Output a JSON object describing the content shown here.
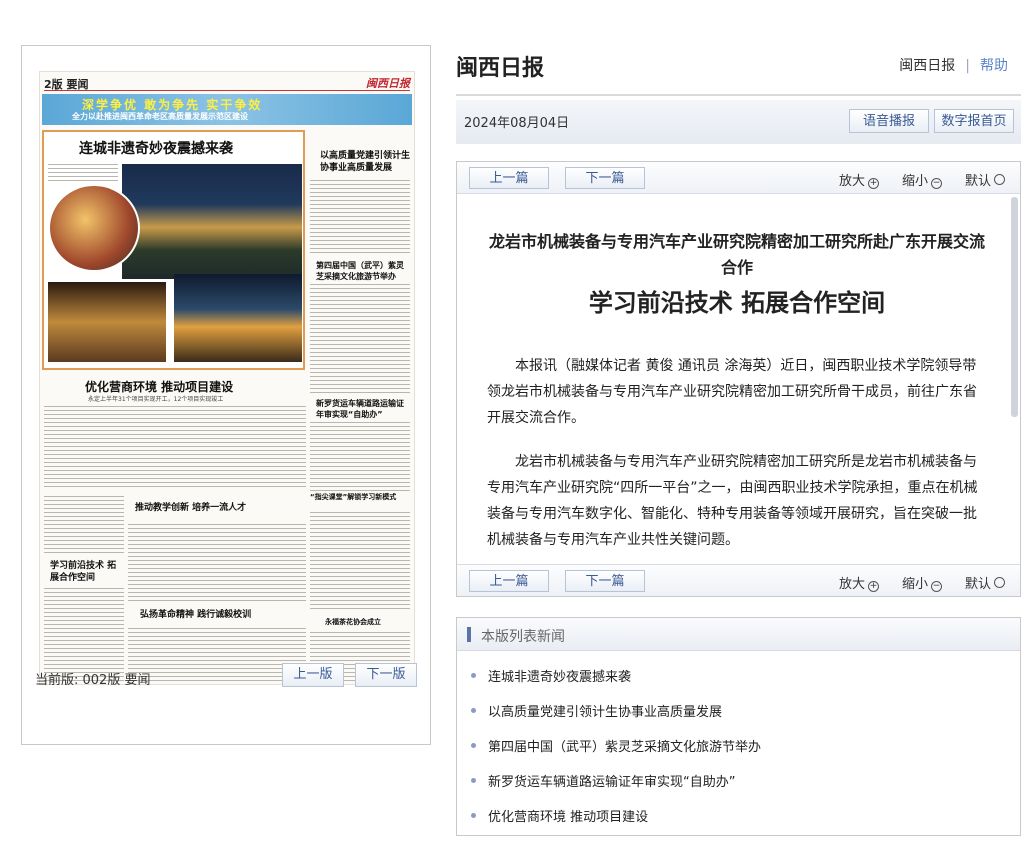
{
  "site": {
    "title": "闽西日报",
    "link_home": "闽西日报",
    "link_help": "帮助"
  },
  "date_bar": {
    "date": "2024年08月04日",
    "voice_button": "语音播报",
    "digital_home_button": "数字报首页"
  },
  "paper": {
    "current_edition": "当前版: 002版 要闻",
    "prev_button": "上一版",
    "next_button": "下一版",
    "page_label": "2版 要闻",
    "masthead": "闽西日报",
    "banner_line1": "深学争优 敢为争先 实干争效",
    "banner_line2": "全力以赴推进闽西革命老区高质量发展示范区建设",
    "feature_title": "连城非遗奇妙夜震撼来袭",
    "headline_2": "优化营商环境 推动项目建设",
    "headline_2_sub": "永定上半年31个项目实现开工，12个项目实现竣工",
    "right_h1": "以高质量党建引领计生协事业高质量发展",
    "right_h2": "第四届中国（武平）紫灵芝采摘文化旅游节举办",
    "right_h3": "新罗货运车辆道路运输证年审实现“自助办”",
    "right_h4": "“指尖课堂”解锁学习新模式",
    "right_h5": "永福茶花协会成立",
    "left_h": "学习前沿技术 拓展合作空间",
    "mid_h1": "推动教学创新 培养一流人才",
    "mid_h2": "弘扬革命精神 践行诚毅校训"
  },
  "article": {
    "prev_button": "上一篇",
    "next_button": "下一篇",
    "zoom_in": "放大",
    "zoom_out": "缩小",
    "zoom_default": "默认",
    "subtitle": "龙岩市机械装备与专用汽车产业研究院精密加工研究所赴广东开展交流合作",
    "title": "学习前沿技术 拓展合作空间",
    "paragraph_1": "本报讯（融媒体记者 黄俊 通讯员 涂海英）近日，闽西职业技术学院领导带领龙岩市机械装备与专用汽车产业研究院精密加工研究所骨干成员，前往广东省开展交流合作。",
    "paragraph_2": "龙岩市机械装备与专用汽车产业研究院精密加工研究所是龙岩市机械装备与专用汽车产业研究院“四所一平台”之一，由闽西职业技术学院承担，重点在机械装备与专用汽车数字化、智能化、特种专用装备等领域开展研究，旨在突破一批机械装备与专用汽车产业共性关键问题。"
  },
  "news_list": {
    "heading": "本版列表新闻",
    "items": [
      "连城非遗奇妙夜震撼来袭",
      "以高质量党建引领计生协事业高质量发展",
      "第四届中国（武平）紫灵芝采摘文化旅游节举办",
      "新罗货运车辆道路运输证年审实现“自助办”",
      "优化营商环境 推动项目建设"
    ]
  }
}
